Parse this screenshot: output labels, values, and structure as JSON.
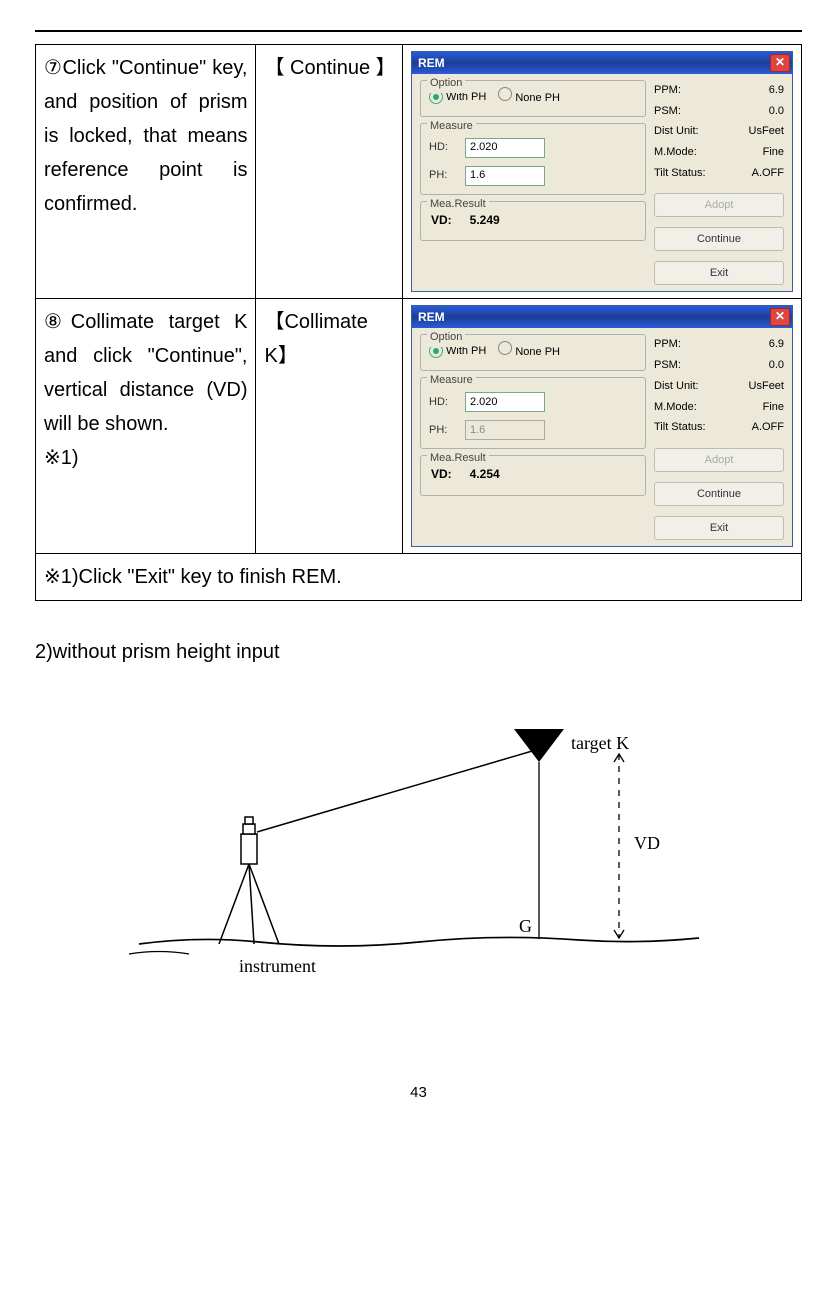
{
  "steps": [
    {
      "desc": "⑦Click \"Continue\" key, and position of prism is locked, that means reference point is confirmed.",
      "key": "【 Continue 】",
      "vd": "5.249",
      "hd": "2.020",
      "ph": "1.6",
      "ph_disabled": false
    },
    {
      "desc": "⑧Collimate target K and click \"Continue\", vertical distance (VD) will be shown.\n※1)",
      "key": "【Collimate K】",
      "vd": "4.254",
      "hd": "2.020",
      "ph": "1.6",
      "ph_disabled": true
    }
  ],
  "footnote": "※1)Click \"Exit\" key to finish REM.",
  "rem": {
    "title": "REM",
    "option_label": "Option",
    "with_ph": "With PH",
    "none_ph": "None PH",
    "measure_label": "Measure",
    "hd_label": "HD:",
    "ph_label": "PH:",
    "result_label": "Mea.Result",
    "vd_label": "VD:",
    "info": {
      "ppm_label": "PPM:",
      "ppm": "6.9",
      "psm_label": "PSM:",
      "psm": "0.0",
      "du_label": "Dist Unit:",
      "du": "UsFeet",
      "mm_label": "M.Mode:",
      "mm": "Fine",
      "ts_label": "Tilt Status:",
      "ts": "A.OFF"
    },
    "btn_adopt": "Adopt",
    "btn_continue": "Continue",
    "btn_exit": "Exit"
  },
  "section2": "2)without prism height input",
  "diagram": {
    "target": "target K",
    "vd": "VD",
    "g": "G",
    "instrument": "instrument"
  },
  "page_number": "43"
}
